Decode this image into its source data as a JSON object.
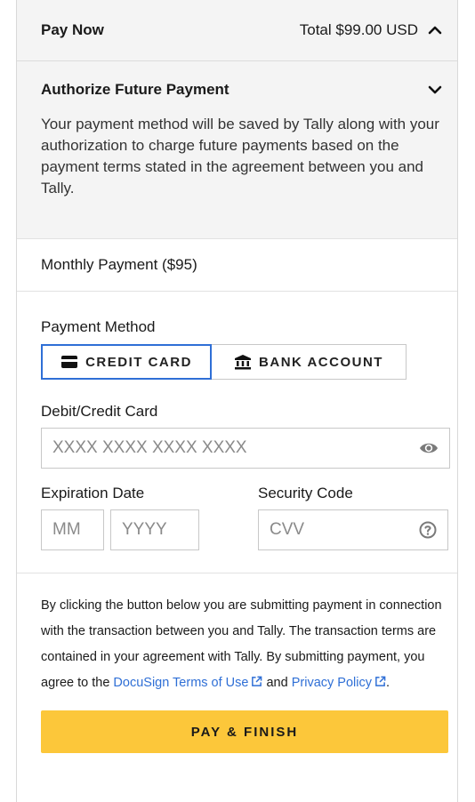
{
  "header": {
    "title": "Pay Now",
    "total": "Total $99.00 USD"
  },
  "authorize": {
    "title": "Authorize Future Payment",
    "text": "Your payment method will be saved by Tally along with your authorization to charge future payments based on the payment terms stated in the agreement between you and Tally."
  },
  "plan": {
    "label": "Monthly Payment ($95)"
  },
  "payment": {
    "method_label": "Payment Method",
    "credit_label": "CREDIT CARD",
    "bank_label": "BANK ACCOUNT",
    "card_label": "Debit/Credit Card",
    "card_placeholder": "XXXX XXXX XXXX XXXX",
    "expiration_label": "Expiration Date",
    "month_placeholder": "MM",
    "year_placeholder": "YYYY",
    "security_label": "Security Code",
    "cvv_placeholder": "CVV"
  },
  "legal": {
    "text": "By clicking the button below you are submitting payment in connection with the transaction between you and Tally. The transaction terms are contained in your agreement with Tally. By submitting payment, you agree to the ",
    "terms_link": "DocuSign Terms of Use",
    "and": " and ",
    "privacy_link": "Privacy Policy",
    "end": "."
  },
  "submit": {
    "label": "PAY & FINISH"
  },
  "icons": {
    "chevron_up": "chevron-up-icon",
    "chevron_down": "chevron-down-icon",
    "credit_card": "credit-card-icon",
    "bank": "bank-icon",
    "eye": "eye-icon",
    "help": "help-circle-icon",
    "external": "external-link-icon"
  },
  "colors": {
    "accent": "#2f6fd6",
    "button": "#fcc73a",
    "panel_bg": "#f4f4f4"
  }
}
